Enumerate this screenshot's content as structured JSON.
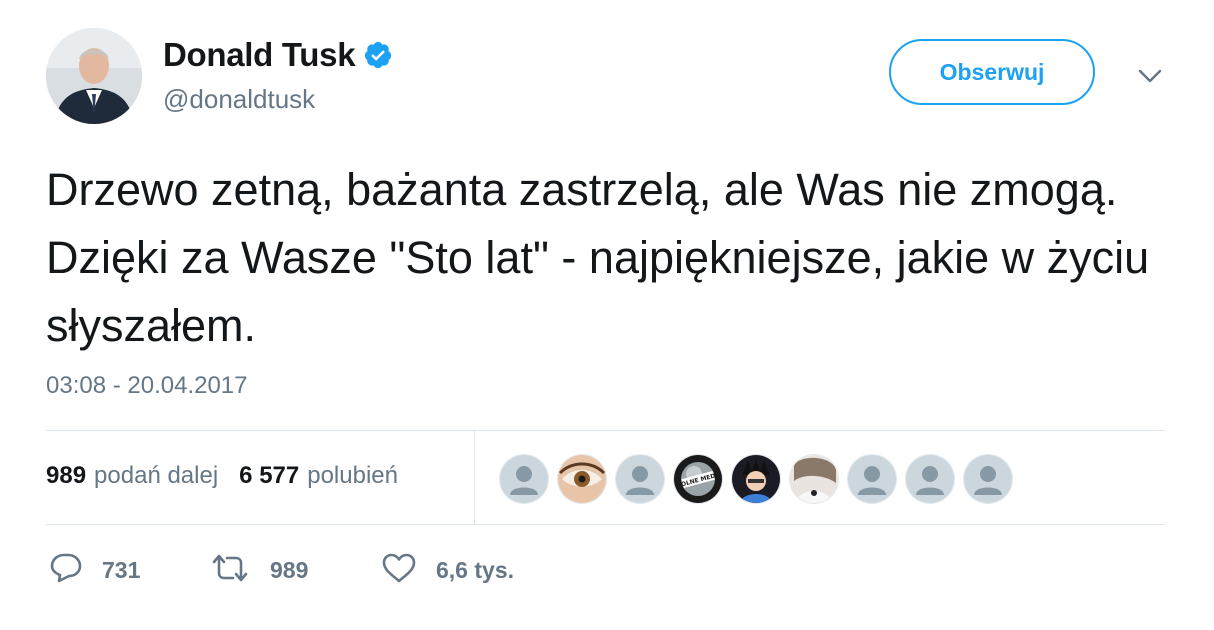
{
  "profile": {
    "name": "Donald Tusk",
    "handle": "@donaldtusk",
    "verified": true
  },
  "follow_button": {
    "label": "Obserwuj"
  },
  "tweet": {
    "text": "Drzewo zetną, bażanta zastrzelą, ale Was nie zmogą. Dzięki za Wasze \"Sto lat\" - najpiękniejsze, jakie w życiu słyszałem.",
    "timestamp": "03:08 - 20.04.2017"
  },
  "stats": {
    "retweets_count": "989",
    "retweets_label": "podań dalej",
    "likes_count": "6 577",
    "likes_label": "polubień"
  },
  "likers": [
    {
      "type": "default-avatar"
    },
    {
      "type": "eye-photo"
    },
    {
      "type": "default-avatar"
    },
    {
      "type": "wolne-media-logo",
      "text": "WOLNE MEDIA"
    },
    {
      "type": "cartoon-avatar"
    },
    {
      "type": "photo-avatar"
    },
    {
      "type": "default-avatar"
    },
    {
      "type": "default-avatar"
    },
    {
      "type": "default-avatar"
    }
  ],
  "actions": {
    "reply_count": "731",
    "retweet_count": "989",
    "like_count": "6,6 tys."
  },
  "colors": {
    "accent": "#1da1f2",
    "text": "#14171a",
    "muted": "#657786",
    "divider": "#e1e8ed"
  }
}
